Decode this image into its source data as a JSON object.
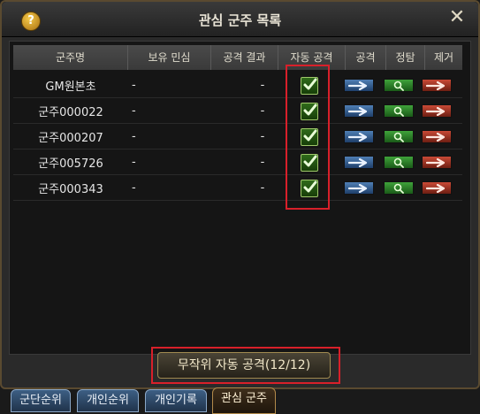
{
  "window": {
    "title": "관심 군주 목록",
    "help_label": "?",
    "close_label": "✕"
  },
  "table": {
    "headers": {
      "name": "군주명",
      "loyalty": "보유 민심",
      "result": "공격 결과",
      "auto": "자동 공격",
      "attack": "공격",
      "scout": "정탐",
      "remove": "제거"
    },
    "rows": [
      {
        "name": "GM원본초",
        "loyalty": "-",
        "result": "-",
        "auto_attack": true
      },
      {
        "name": "군주000022",
        "loyalty": "-",
        "result": "-",
        "auto_attack": true
      },
      {
        "name": "군주000207",
        "loyalty": "-",
        "result": "-",
        "auto_attack": true
      },
      {
        "name": "군주005726",
        "loyalty": "-",
        "result": "-",
        "auto_attack": true
      },
      {
        "name": "군주000343",
        "loyalty": "-",
        "result": "-",
        "auto_attack": true
      }
    ]
  },
  "random_button": {
    "label": "무작위 자동 공격(12/12)"
  },
  "tabs": [
    {
      "label": "군단순위",
      "active": false
    },
    {
      "label": "개인순위",
      "active": false
    },
    {
      "label": "개인기록",
      "active": false
    },
    {
      "label": "관심 군주",
      "active": true
    }
  ],
  "icons": {
    "help": "help-icon",
    "close": "close-icon",
    "check": "check-icon",
    "attack": "arrow-right-icon",
    "scout": "magnifier-icon",
    "remove": "arrow-right-red-icon"
  },
  "colors": {
    "highlight": "#d8202a",
    "attack_btn": "#3d6ea8",
    "scout_btn": "#2f8a2a",
    "remove_btn": "#b53a28",
    "tab_blue": "#3d5f84",
    "tab_active": "#3e2e1b"
  }
}
